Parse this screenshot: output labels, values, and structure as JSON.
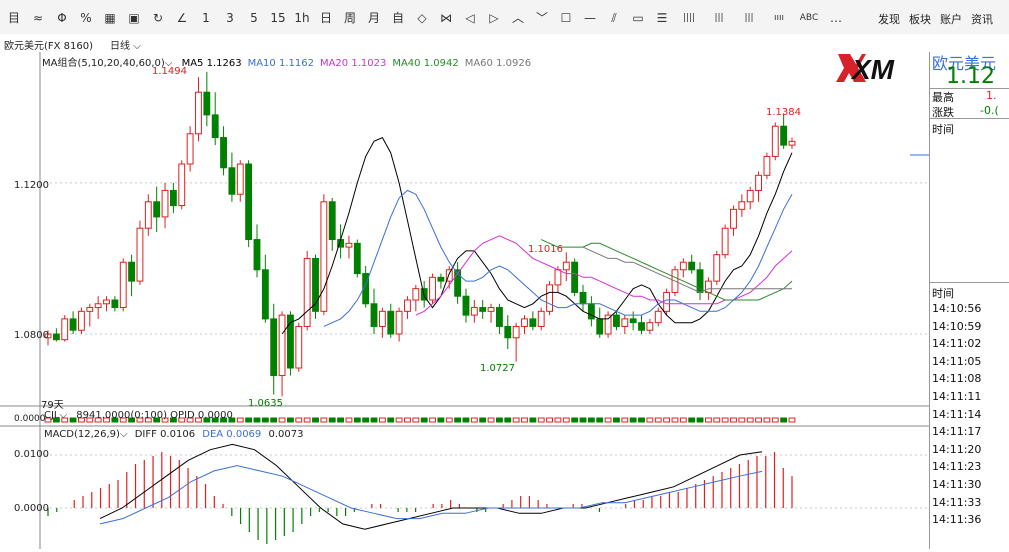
{
  "toolbar": {
    "tools": [
      {
        "label": "目",
        "icon": "layout-icon"
      },
      {
        "label": "≈",
        "icon": "line-chart-icon"
      },
      {
        "label": "Φ",
        "icon": "candle-icon"
      },
      {
        "label": "%",
        "icon": "percent-icon"
      },
      {
        "label": "▦",
        "icon": "grid-icon"
      },
      {
        "label": "▣",
        "icon": "save-icon"
      },
      {
        "label": "↻",
        "icon": "refresh-icon"
      },
      {
        "label": "∠",
        "icon": "draw-icon"
      },
      {
        "label": "1",
        "icon": "period-1"
      },
      {
        "label": "3",
        "icon": "period-3"
      },
      {
        "label": "5",
        "icon": "period-5"
      },
      {
        "label": "15",
        "icon": "period-15"
      },
      {
        "label": "1h",
        "icon": "period-1h"
      },
      {
        "label": "日",
        "icon": "period-day"
      },
      {
        "label": "周",
        "icon": "period-week"
      },
      {
        "label": "月",
        "icon": "period-month"
      },
      {
        "label": "自",
        "icon": "period-custom"
      },
      {
        "label": "◇",
        "icon": "diamond-icon"
      },
      {
        "label": "⋈",
        "icon": "bowtie-icon"
      },
      {
        "label": "◁",
        "icon": "arrow-left-icon"
      },
      {
        "label": "▷",
        "icon": "arrow-right-icon"
      },
      {
        "label": "︿",
        "icon": "zoom-in-icon"
      },
      {
        "label": "﹀",
        "icon": "zoom-out-icon"
      },
      {
        "label": "☐",
        "icon": "box-icon"
      },
      {
        "label": "—",
        "icon": "hline-icon"
      },
      {
        "label": "⫽",
        "icon": "trend-icon"
      },
      {
        "label": "▭",
        "icon": "rect-icon"
      },
      {
        "label": "☰",
        "icon": "channel-icon"
      },
      {
        "label": "||||",
        "icon": "bars4-icon"
      },
      {
        "label": "|||",
        "icon": "bars3-icon"
      },
      {
        "label": "|||",
        "icon": "bars3b-icon"
      },
      {
        "label": "ıııı",
        "icon": "volume-icon"
      },
      {
        "label": "ABC",
        "icon": "text-icon"
      },
      {
        "label": "…",
        "icon": "more-icon"
      }
    ],
    "right_links": [
      "发现",
      "板块",
      "账户",
      "资讯"
    ]
  },
  "subbar": {
    "symbol": "欧元美元(FX 8160)",
    "period": "日线"
  },
  "ma_legend": {
    "group": "MA组合(5,10,20,40,60,0)",
    "items": [
      {
        "text": "MA5 1.1263",
        "color": "#000000"
      },
      {
        "text": "MA10 1.1162",
        "color": "#3b6fd6"
      },
      {
        "text": "MA20 1.1023",
        "color": "#d62fd6"
      },
      {
        "text": "MA40 1.0942",
        "color": "#2a8a2a"
      },
      {
        "text": "MA60 1.0926",
        "color": "#777777"
      }
    ]
  },
  "price_axis": [
    "1.1200",
    "1.0800"
  ],
  "annotations": [
    "1.1494",
    "1.1384",
    "1.1016",
    "1.0727",
    "1.0635"
  ],
  "days_label": "79天",
  "volume_legend": {
    "name": "CJL",
    "text": "8941.0000(0:100)  OPID 0.0000"
  },
  "volume_axis": "0.0000",
  "macd_legend": {
    "name": "MACD(12,26,9)",
    "diff": "DIFF 0.0106",
    "dea": "DEA 0.0069",
    "val": "0.0073"
  },
  "macd_axis": [
    "0.0100",
    "0.0000"
  ],
  "right_panel": {
    "name": "欧元美元",
    "price": "1.12",
    "high_label": "最高",
    "high_val": "1.",
    "change_label": "涨跌",
    "change_val": "-0.(",
    "time_header": "时间",
    "time_header2": "时间",
    "times": [
      "14:10:56",
      "14:10:59",
      "14:11:02",
      "14:11:05",
      "14:11:08",
      "14:11:11",
      "14:11:14",
      "14:11:17",
      "14:11:20",
      "14:11:23",
      "14:11:30",
      "14:11:33",
      "14:11:36"
    ]
  },
  "logo": "XM",
  "colors": {
    "up": "#e02020",
    "down": "#008000",
    "bg": "#ffffff"
  },
  "chart_data": [
    {
      "type": "candlestick",
      "title": "欧元美元(FX 8160) 日线",
      "ylim": [
        1.062,
        1.152
      ],
      "yticks": [
        1.12,
        1.08
      ],
      "candles": [
        [
          1.079,
          1.081,
          1.077,
          1.08
        ],
        [
          1.08,
          1.0815,
          1.078,
          1.0785
        ],
        [
          1.0785,
          1.085,
          1.078,
          1.084
        ],
        [
          1.084,
          1.086,
          1.08,
          1.081
        ],
        [
          1.081,
          1.087,
          1.08,
          1.086
        ],
        [
          1.086,
          1.088,
          1.082,
          1.087
        ],
        [
          1.087,
          1.09,
          1.084,
          1.088
        ],
        [
          1.088,
          1.09,
          1.086,
          1.089
        ],
        [
          1.089,
          1.09,
          1.086,
          1.087
        ],
        [
          1.087,
          1.1,
          1.086,
          1.099
        ],
        [
          1.099,
          1.101,
          1.09,
          1.094
        ],
        [
          1.094,
          1.11,
          1.093,
          1.108
        ],
        [
          1.108,
          1.117,
          1.106,
          1.115
        ],
        [
          1.115,
          1.119,
          1.107,
          1.111
        ],
        [
          1.111,
          1.12,
          1.108,
          1.118
        ],
        [
          1.118,
          1.12,
          1.112,
          1.114
        ],
        [
          1.114,
          1.126,
          1.113,
          1.125
        ],
        [
          1.125,
          1.135,
          1.123,
          1.133
        ],
        [
          1.133,
          1.148,
          1.131,
          1.144
        ],
        [
          1.144,
          1.1494,
          1.135,
          1.138
        ],
        [
          1.138,
          1.144,
          1.13,
          1.132
        ],
        [
          1.132,
          1.135,
          1.122,
          1.124
        ],
        [
          1.124,
          1.128,
          1.115,
          1.117
        ],
        [
          1.117,
          1.126,
          1.115,
          1.125
        ],
        [
          1.125,
          1.126,
          1.103,
          1.105
        ],
        [
          1.105,
          1.109,
          1.095,
          1.097
        ],
        [
          1.097,
          1.101,
          1.083,
          1.084
        ],
        [
          1.084,
          1.088,
          1.064,
          1.069
        ],
        [
          1.069,
          1.086,
          1.0635,
          1.085
        ],
        [
          1.085,
          1.086,
          1.069,
          1.071
        ],
        [
          1.071,
          1.083,
          1.07,
          1.082
        ],
        [
          1.082,
          1.102,
          1.081,
          1.1
        ],
        [
          1.1,
          1.101,
          1.084,
          1.086
        ],
        [
          1.086,
          1.117,
          1.085,
          1.115
        ],
        [
          1.115,
          1.116,
          1.102,
          1.105
        ],
        [
          1.105,
          1.109,
          1.1,
          1.103
        ],
        [
          1.103,
          1.106,
          1.1,
          1.104
        ],
        [
          1.104,
          1.105,
          1.095,
          1.096
        ],
        [
          1.096,
          1.098,
          1.087,
          1.088
        ],
        [
          1.088,
          1.092,
          1.08,
          1.082
        ],
        [
          1.082,
          1.087,
          1.079,
          1.086
        ],
        [
          1.086,
          1.088,
          1.079,
          1.08
        ],
        [
          1.08,
          1.087,
          1.078,
          1.086
        ],
        [
          1.086,
          1.09,
          1.084,
          1.089
        ],
        [
          1.089,
          1.093,
          1.086,
          1.092
        ],
        [
          1.092,
          1.094,
          1.087,
          1.089
        ],
        [
          1.089,
          1.096,
          1.088,
          1.095
        ],
        [
          1.095,
          1.096,
          1.092,
          1.094
        ],
        [
          1.094,
          1.098,
          1.092,
          1.097
        ],
        [
          1.097,
          1.099,
          1.088,
          1.09
        ],
        [
          1.09,
          1.092,
          1.083,
          1.085
        ],
        [
          1.085,
          1.089,
          1.083,
          1.087
        ],
        [
          1.087,
          1.089,
          1.084,
          1.086
        ],
        [
          1.086,
          1.088,
          1.083,
          1.087
        ],
        [
          1.087,
          1.088,
          1.08,
          1.082
        ],
        [
          1.082,
          1.085,
          1.076,
          1.079
        ],
        [
          1.079,
          1.083,
          1.0727,
          1.082
        ],
        [
          1.082,
          1.085,
          1.08,
          1.084
        ],
        [
          1.084,
          1.086,
          1.081,
          1.082
        ],
        [
          1.082,
          1.087,
          1.081,
          1.086
        ],
        [
          1.086,
          1.094,
          1.085,
          1.093
        ],
        [
          1.093,
          1.098,
          1.091,
          1.097
        ],
        [
          1.097,
          1.1016,
          1.094,
          1.099
        ],
        [
          1.099,
          1.1,
          1.09,
          1.091
        ],
        [
          1.091,
          1.093,
          1.086,
          1.088
        ],
        [
          1.088,
          1.09,
          1.082,
          1.084
        ],
        [
          1.084,
          1.087,
          1.079,
          1.08
        ],
        [
          1.08,
          1.086,
          1.079,
          1.085
        ],
        [
          1.085,
          1.086,
          1.081,
          1.082
        ],
        [
          1.082,
          1.085,
          1.08,
          1.084
        ],
        [
          1.084,
          1.086,
          1.081,
          1.083
        ],
        [
          1.083,
          1.085,
          1.08,
          1.081
        ],
        [
          1.081,
          1.084,
          1.08,
          1.083
        ],
        [
          1.083,
          1.087,
          1.082,
          1.086
        ],
        [
          1.086,
          1.092,
          1.085,
          1.091
        ],
        [
          1.091,
          1.098,
          1.09,
          1.097
        ],
        [
          1.097,
          1.1,
          1.095,
          1.099
        ],
        [
          1.099,
          1.101,
          1.096,
          1.097
        ],
        [
          1.097,
          1.099,
          1.089,
          1.091
        ],
        [
          1.091,
          1.095,
          1.089,
          1.094
        ],
        [
          1.094,
          1.102,
          1.093,
          1.101
        ],
        [
          1.101,
          1.109,
          1.1,
          1.108
        ],
        [
          1.108,
          1.114,
          1.106,
          1.113
        ],
        [
          1.113,
          1.117,
          1.111,
          1.115
        ],
        [
          1.115,
          1.119,
          1.113,
          1.118
        ],
        [
          1.118,
          1.123,
          1.115,
          1.122
        ],
        [
          1.122,
          1.128,
          1.121,
          1.127
        ],
        [
          1.127,
          1.136,
          1.126,
          1.135
        ],
        [
          1.135,
          1.1384,
          1.129,
          1.13
        ],
        [
          1.13,
          1.132,
          1.129,
          1.131
        ]
      ],
      "series": [
        {
          "name": "MA5",
          "values": [
            1.08,
            1.083,
            1.084,
            1.086,
            1.088,
            1.092,
            1.098,
            1.105,
            1.112,
            1.12,
            1.127,
            1.131,
            1.132,
            1.128,
            1.12,
            1.11,
            1.1,
            1.09,
            1.087,
            1.09,
            1.096,
            1.1,
            1.102,
            1.102,
            1.099,
            1.096,
            1.092,
            1.089,
            1.088,
            1.087,
            1.088,
            1.09,
            1.091,
            1.091,
            1.09,
            1.088,
            1.086,
            1.085,
            1.084,
            1.084,
            1.086,
            1.089,
            1.092,
            1.093,
            1.092,
            1.088,
            1.085,
            1.083,
            1.083,
            1.083,
            1.084,
            1.086,
            1.09,
            1.094,
            1.097,
            1.098,
            1.101,
            1.106,
            1.112,
            1.117,
            1.123,
            1.128
          ]
        },
        {
          "name": "MA10",
          "values": [
            1.082,
            1.083,
            1.084,
            1.086,
            1.089,
            1.093,
            1.099,
            1.105,
            1.111,
            1.116,
            1.118,
            1.117,
            1.113,
            1.108,
            1.103,
            1.099,
            1.096,
            1.094,
            1.094,
            1.095,
            1.097,
            1.098,
            1.097,
            1.095,
            1.093,
            1.091,
            1.089,
            1.088,
            1.087,
            1.087,
            1.088,
            1.088,
            1.088,
            1.088,
            1.087,
            1.086,
            1.085,
            1.085,
            1.085,
            1.086,
            1.088,
            1.089,
            1.089,
            1.088,
            1.087,
            1.086,
            1.086,
            1.086,
            1.087,
            1.089,
            1.091,
            1.094,
            1.098,
            1.103,
            1.108,
            1.113,
            1.117
          ]
        },
        {
          "name": "MA20",
          "values": [
            1.085,
            1.086,
            1.088,
            1.09,
            1.093,
            1.096,
            1.099,
            1.102,
            1.104,
            1.105,
            1.106,
            1.105,
            1.104,
            1.102,
            1.1,
            1.099,
            1.098,
            1.097,
            1.096,
            1.096,
            1.095,
            1.095,
            1.094,
            1.093,
            1.092,
            1.091,
            1.09,
            1.09,
            1.089,
            1.089,
            1.088,
            1.088,
            1.088,
            1.088,
            1.088,
            1.088,
            1.088,
            1.089,
            1.089,
            1.09,
            1.091,
            1.093,
            1.095,
            1.098,
            1.1,
            1.102
          ]
        },
        {
          "name": "MA40",
          "values": [
            1.105,
            1.104,
            1.103,
            1.103,
            1.103,
            1.103,
            1.104,
            1.104,
            1.103,
            1.102,
            1.101,
            1.1,
            1.099,
            1.098,
            1.097,
            1.096,
            1.095,
            1.094,
            1.093,
            1.092,
            1.091,
            1.09,
            1.089,
            1.089,
            1.089,
            1.089,
            1.089,
            1.09,
            1.091,
            1.092,
            1.094
          ]
        },
        {
          "name": "MA60",
          "values": [
            1.103,
            1.102,
            1.101,
            1.1,
            1.1,
            1.099,
            1.099,
            1.098,
            1.097,
            1.096,
            1.095,
            1.094,
            1.093,
            1.092,
            1.091,
            1.092,
            1.092,
            1.092,
            1.092,
            1.092,
            1.092,
            1.092,
            1.092,
            1.092,
            1.092,
            1.092
          ]
        }
      ],
      "macd_hist": [
        -2,
        -1,
        0,
        2,
        3,
        4,
        5,
        6,
        7,
        9,
        11,
        12,
        13,
        14,
        13,
        12,
        10,
        8,
        6,
        3,
        1,
        -2,
        -4,
        -6,
        -8,
        -9,
        -8,
        -7,
        -6,
        -4,
        -2,
        -1,
        -1,
        -2,
        -2,
        -1,
        0,
        1,
        1,
        0,
        -1,
        -1,
        -1,
        0,
        1,
        1,
        2,
        1,
        0,
        -1,
        -1,
        0,
        1,
        2,
        3,
        3,
        2,
        1,
        0,
        0,
        1,
        1,
        0,
        -1,
        0,
        0,
        1,
        2,
        2,
        3,
        3,
        4,
        4,
        5,
        6,
        7,
        8,
        9,
        10,
        11,
        12,
        13,
        13,
        14,
        10,
        8
      ],
      "macd_diff": [
        -0.002,
        0,
        0.003,
        0.006,
        0.009,
        0.011,
        0.012,
        0.011,
        0.008,
        0.004,
        0,
        -0.003,
        -0.004,
        -0.003,
        -0.002,
        -0.001,
        0,
        0,
        0,
        -0.001,
        -0.001,
        0,
        0,
        0.001,
        0.002,
        0.003,
        0.004,
        0.006,
        0.008,
        0.01,
        0.0106
      ],
      "macd_dea": [
        -0.003,
        -0.002,
        0,
        0.002,
        0.005,
        0.007,
        0.008,
        0.007,
        0.006,
        0.004,
        0.002,
        0,
        -0.001,
        -0.002,
        -0.002,
        -0.001,
        -0.001,
        0,
        0,
        0,
        0,
        0,
        0.001,
        0.001,
        0.002,
        0.003,
        0.004,
        0.005,
        0.006,
        0.0069
      ]
    }
  ]
}
